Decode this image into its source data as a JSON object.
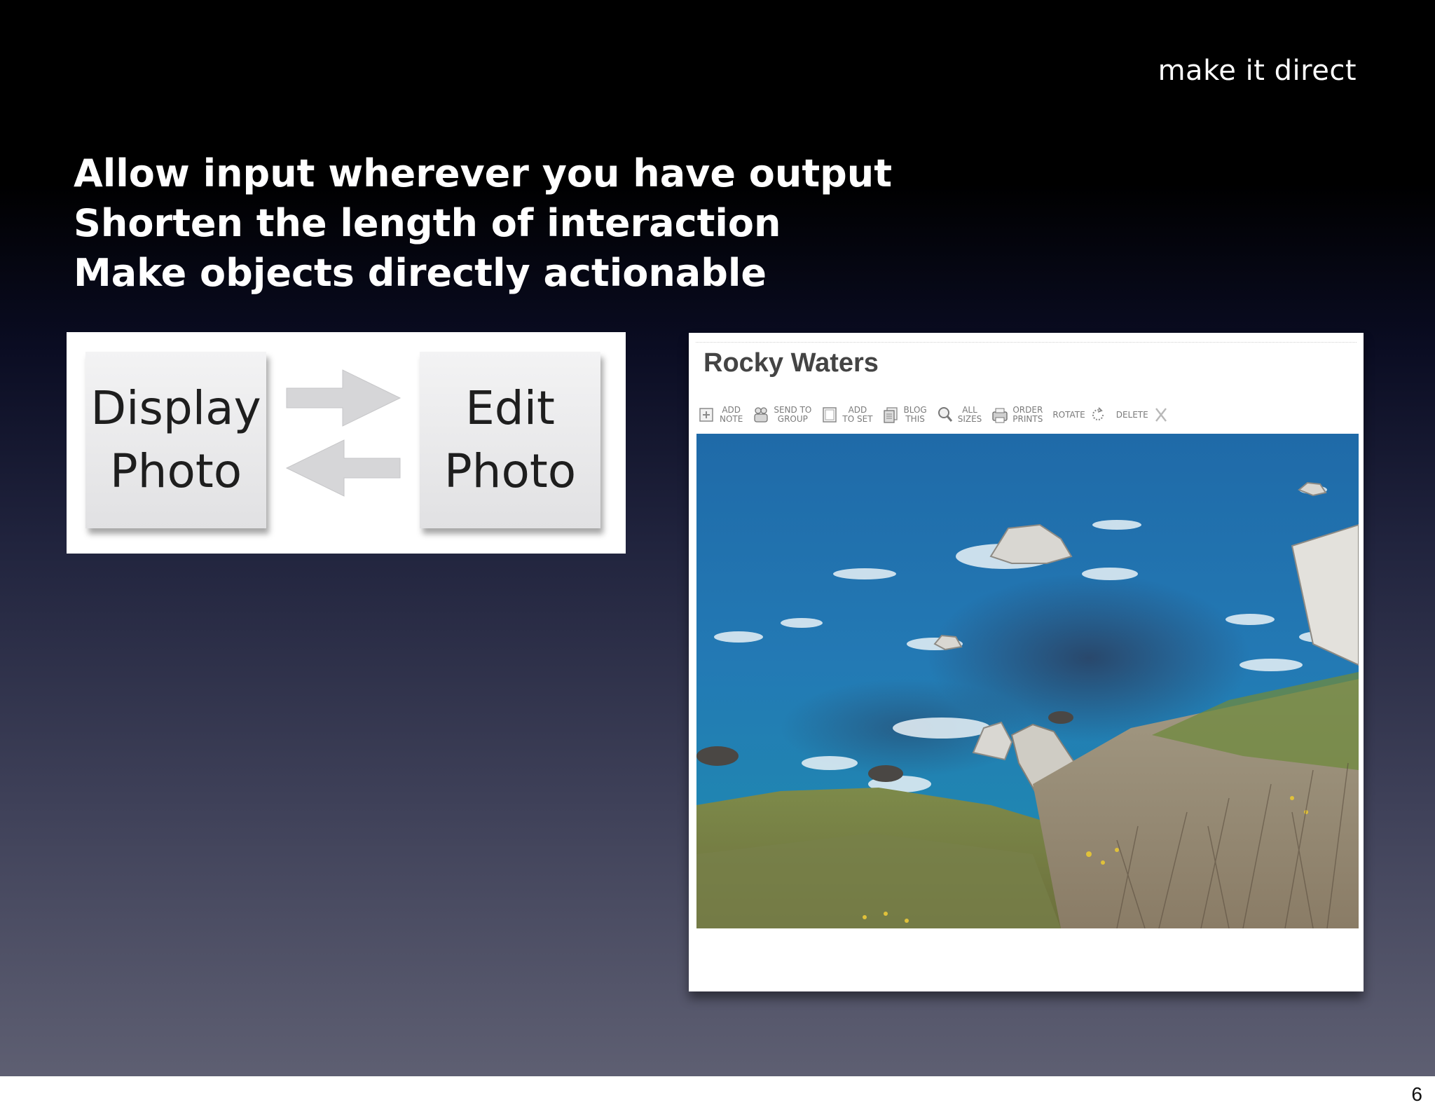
{
  "slide": {
    "section_label": "make it direct",
    "bullets": [
      "Allow input wherever you have output",
      "Shorten the length of interaction",
      "Make objects directly actionable"
    ],
    "page_number": "6"
  },
  "diagram": {
    "display_box": [
      "Display",
      "Photo"
    ],
    "edit_box": [
      "Edit",
      "Photo"
    ],
    "arrows": [
      "arrow-right-icon",
      "arrow-left-icon"
    ]
  },
  "photo_page": {
    "title": "Rocky Waters",
    "toolbar": [
      {
        "label": "ADD\nNOTE",
        "icon": "add-note-icon"
      },
      {
        "label": "SEND TO\nGROUP",
        "icon": "send-to-group-icon"
      },
      {
        "label": "ADD\nTO SET",
        "icon": "add-to-set-icon"
      },
      {
        "label": "BLOG\nTHIS",
        "icon": "blog-this-icon"
      },
      {
        "label": "ALL\nSIZES",
        "icon": "all-sizes-icon"
      },
      {
        "label": "ORDER\nPRINTS",
        "icon": "order-prints-icon"
      },
      {
        "label": "ROTATE",
        "icon": "rotate-icon"
      },
      {
        "label": "DELETE",
        "icon": "delete-icon"
      }
    ],
    "image": "coastal-ocean-photo"
  }
}
